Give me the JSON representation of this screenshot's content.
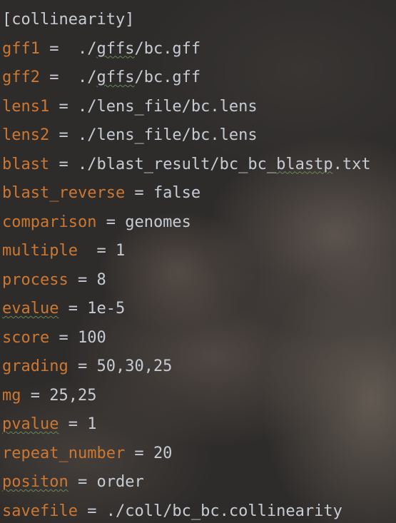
{
  "editor": {
    "section_header": "[collinearity]",
    "lines": [
      {
        "key": "gff1",
        "eq": " =  ",
        "val_pre": "./",
        "val_typo": "gffs",
        "val_post": "/bc.gff"
      },
      {
        "key": "gff2",
        "eq": " =  ",
        "val_pre": "./",
        "val_typo": "gffs",
        "val_post": "/bc.gff"
      },
      {
        "key": "lens1",
        "eq": " = ",
        "val_pre": "./lens_file/bc.lens",
        "val_typo": "",
        "val_post": ""
      },
      {
        "key": "lens2",
        "eq": " = ",
        "val_pre": "./lens_file/bc.lens",
        "val_typo": "",
        "val_post": ""
      },
      {
        "key": "blast",
        "eq": " = ",
        "val_pre": "./blast_result/bc_bc_",
        "val_typo": "blastp",
        "val_post": ".txt"
      },
      {
        "key": "blast_reverse",
        "eq": " = ",
        "val_pre": "false",
        "val_typo": "",
        "val_post": ""
      },
      {
        "key": "comparison",
        "eq": " = ",
        "val_pre": "genomes",
        "val_typo": "",
        "val_post": ""
      },
      {
        "key": "multiple",
        "eq": "  = ",
        "val_pre": "1",
        "val_typo": "",
        "val_post": ""
      },
      {
        "key": "process",
        "eq": " = ",
        "val_pre": "8",
        "val_typo": "",
        "val_post": ""
      },
      {
        "key": "evalue",
        "eq": " = ",
        "val_pre": "1e-5",
        "val_typo": "",
        "val_post": ""
      },
      {
        "key": "score",
        "eq": " = ",
        "val_pre": "100",
        "val_typo": "",
        "val_post": ""
      },
      {
        "key": "grading",
        "eq": " = ",
        "val_pre": "50,30,25",
        "val_typo": "",
        "val_post": ""
      },
      {
        "key": "mg",
        "eq": " = ",
        "val_pre": "25,25",
        "val_typo": "",
        "val_post": ""
      },
      {
        "key": "pvalue",
        "eq": " = ",
        "val_pre": "1",
        "val_typo": "",
        "val_post": ""
      },
      {
        "key": "repeat_number",
        "eq": " = ",
        "val_pre": "20",
        "val_typo": "",
        "val_post": ""
      },
      {
        "key": "positon",
        "eq": " = ",
        "val_pre": "order",
        "val_typo": "",
        "val_post": ""
      },
      {
        "key": "savefile",
        "eq": " = ",
        "val_pre": "./coll/bc_bc.collinearity",
        "val_typo": "",
        "val_post": ""
      }
    ]
  },
  "colors": {
    "key": "#cc7832",
    "text": "#c7ccd3",
    "typo_underline": "#6a8759"
  }
}
